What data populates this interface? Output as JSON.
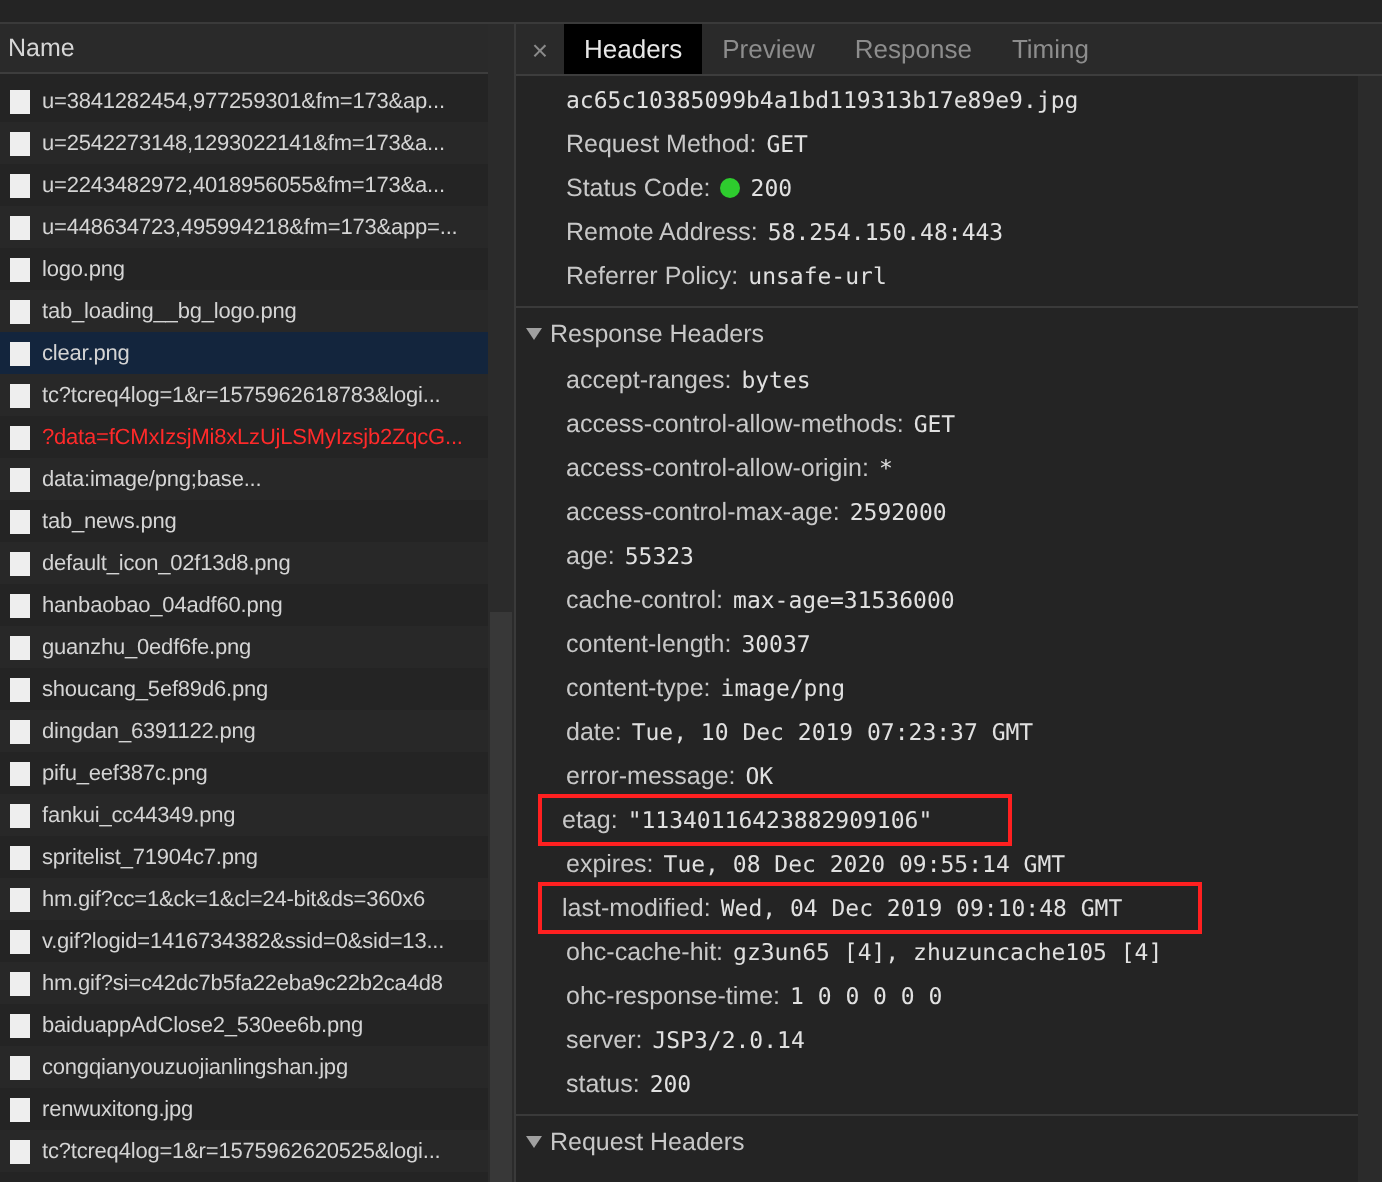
{
  "requests": {
    "column": "Name",
    "rows": [
      {
        "name": "u=3841282454,977259301&fm=173&ap...",
        "selected": false,
        "error": false
      },
      {
        "name": "u=2542273148,1293022141&fm=173&a...",
        "selected": false,
        "error": false
      },
      {
        "name": "u=2243482972,4018956055&fm=173&a...",
        "selected": false,
        "error": false
      },
      {
        "name": "u=448634723,495994218&fm=173&app=...",
        "selected": false,
        "error": false
      },
      {
        "name": "logo.png",
        "selected": false,
        "error": false
      },
      {
        "name": "tab_loading__bg_logo.png",
        "selected": false,
        "error": false
      },
      {
        "name": "clear.png",
        "selected": true,
        "error": false
      },
      {
        "name": "tc?tcreq4log=1&r=1575962618783&logi...",
        "selected": false,
        "error": false
      },
      {
        "name": "?data=fCMxIzsjMi8xLzUjLSMyIzsjb2ZqcG...",
        "selected": false,
        "error": true
      },
      {
        "name": "data:image/png;base...",
        "selected": false,
        "error": false
      },
      {
        "name": "tab_news.png",
        "selected": false,
        "error": false
      },
      {
        "name": "default_icon_02f13d8.png",
        "selected": false,
        "error": false
      },
      {
        "name": "hanbaobao_04adf60.png",
        "selected": false,
        "error": false
      },
      {
        "name": "guanzhu_0edf6fe.png",
        "selected": false,
        "error": false
      },
      {
        "name": "shoucang_5ef89d6.png",
        "selected": false,
        "error": false
      },
      {
        "name": "dingdan_6391122.png",
        "selected": false,
        "error": false
      },
      {
        "name": "pifu_eef387c.png",
        "selected": false,
        "error": false
      },
      {
        "name": "fankui_cc44349.png",
        "selected": false,
        "error": false
      },
      {
        "name": "spritelist_71904c7.png",
        "selected": false,
        "error": false
      },
      {
        "name": "hm.gif?cc=1&ck=1&cl=24-bit&ds=360x6",
        "selected": false,
        "error": false
      },
      {
        "name": "v.gif?logid=1416734382&ssid=0&sid=13...",
        "selected": false,
        "error": false
      },
      {
        "name": "hm.gif?si=c42dc7b5fa22eba9c22b2ca4d8",
        "selected": false,
        "error": false
      },
      {
        "name": "baiduappAdClose2_530ee6b.png",
        "selected": false,
        "error": false
      },
      {
        "name": "congqianyouzuojianlingshan.jpg",
        "selected": false,
        "error": false
      },
      {
        "name": "renwuxitong.jpg",
        "selected": false,
        "error": false
      },
      {
        "name": "tc?tcreq4log=1&r=1575962620525&logi...",
        "selected": false,
        "error": false
      }
    ]
  },
  "close_button": "×",
  "tabs": [
    {
      "label": "Headers",
      "selected": true
    },
    {
      "label": "Preview",
      "selected": false
    },
    {
      "label": "Response",
      "selected": false
    },
    {
      "label": "Timing",
      "selected": false
    }
  ],
  "general": {
    "url_tail": "ac65c10385099b4a1bd119313b17e89e9.jpg",
    "fields": [
      {
        "key": "Request Method:",
        "value": "GET"
      },
      {
        "key": "Status Code:",
        "value": "200",
        "kind": "status"
      },
      {
        "key": "Remote Address:",
        "value": "58.254.150.48:443"
      },
      {
        "key": "Referrer Policy:",
        "value": "unsafe-url"
      }
    ]
  },
  "response_headers": {
    "title": "Response Headers",
    "expanded": true,
    "headers": [
      {
        "key": "accept-ranges:",
        "value": "bytes",
        "highlighted": false
      },
      {
        "key": "access-control-allow-methods:",
        "value": "GET",
        "highlighted": false
      },
      {
        "key": "access-control-allow-origin:",
        "value": "*",
        "highlighted": false
      },
      {
        "key": "access-control-max-age:",
        "value": "2592000",
        "highlighted": false
      },
      {
        "key": "age:",
        "value": "55323",
        "highlighted": false
      },
      {
        "key": "cache-control:",
        "value": "max-age=31536000",
        "highlighted": false
      },
      {
        "key": "content-length:",
        "value": "30037",
        "highlighted": false
      },
      {
        "key": "content-type:",
        "value": "image/png",
        "highlighted": false
      },
      {
        "key": "date:",
        "value": "Tue, 10 Dec 2019 07:23:37 GMT",
        "highlighted": false
      },
      {
        "key": "error-message:",
        "value": "OK",
        "highlighted": false
      },
      {
        "key": "etag:",
        "value": "\"11340116423882909106\"",
        "highlighted": true
      },
      {
        "key": "expires:",
        "value": "Tue, 08 Dec 2020 09:55:14 GMT",
        "highlighted": false
      },
      {
        "key": "last-modified:",
        "value": "Wed, 04 Dec 2019 09:10:48 GMT",
        "highlighted": true
      },
      {
        "key": "ohc-cache-hit:",
        "value": "gz3un65 [4], zhuzuncache105 [4]",
        "highlighted": false
      },
      {
        "key": "ohc-response-time:",
        "value": "1 0 0 0 0 0",
        "highlighted": false
      },
      {
        "key": "server:",
        "value": "JSP3/2.0.14",
        "highlighted": false
      },
      {
        "key": "status:",
        "value": "200",
        "highlighted": false
      }
    ]
  },
  "request_headers": {
    "title": "Request Headers",
    "expanded": true
  }
}
